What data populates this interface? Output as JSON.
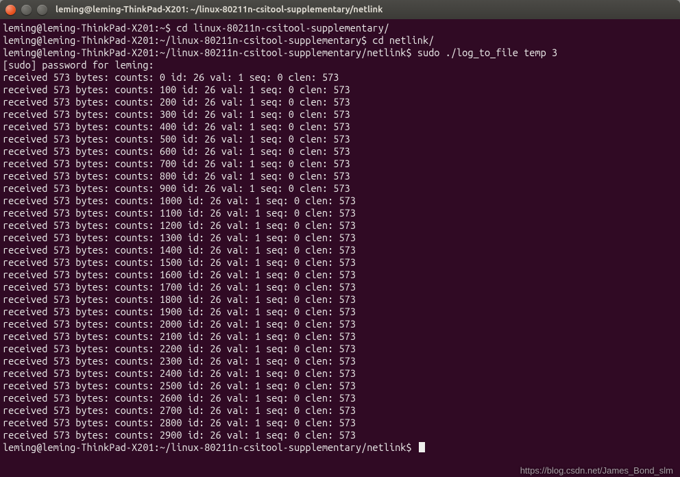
{
  "titlebar": {
    "title": "leming@leming-ThinkPad-X201: ~/linux-80211n-csitool-supplementary/netlink"
  },
  "prompts": {
    "p1": "leming@leming-ThinkPad-X201:~$ ",
    "p2": "leming@leming-ThinkPad-X201:~/linux-80211n-csitool-supplementary$ ",
    "p3": "leming@leming-ThinkPad-X201:~/linux-80211n-csitool-supplementary/netlink$ "
  },
  "commands": {
    "c1": "cd linux-80211n-csitool-supplementary/",
    "c2": "cd netlink/",
    "c3": "sudo ./log_to_file temp 3"
  },
  "sudo_prompt": "[sudo] password for leming: ",
  "log_template": {
    "prefix": "received 573 bytes: counts: ",
    "suffix": " id: 26 val: 1 seq: 0 clen: 573"
  },
  "log_counts": [
    0,
    100,
    200,
    300,
    400,
    500,
    600,
    700,
    800,
    900,
    1000,
    1100,
    1200,
    1300,
    1400,
    1500,
    1600,
    1700,
    1800,
    1900,
    2000,
    2100,
    2200,
    2300,
    2400,
    2500,
    2600,
    2700,
    2800,
    2900
  ],
  "watermark": "https://blog.csdn.net/James_Bond_slm"
}
